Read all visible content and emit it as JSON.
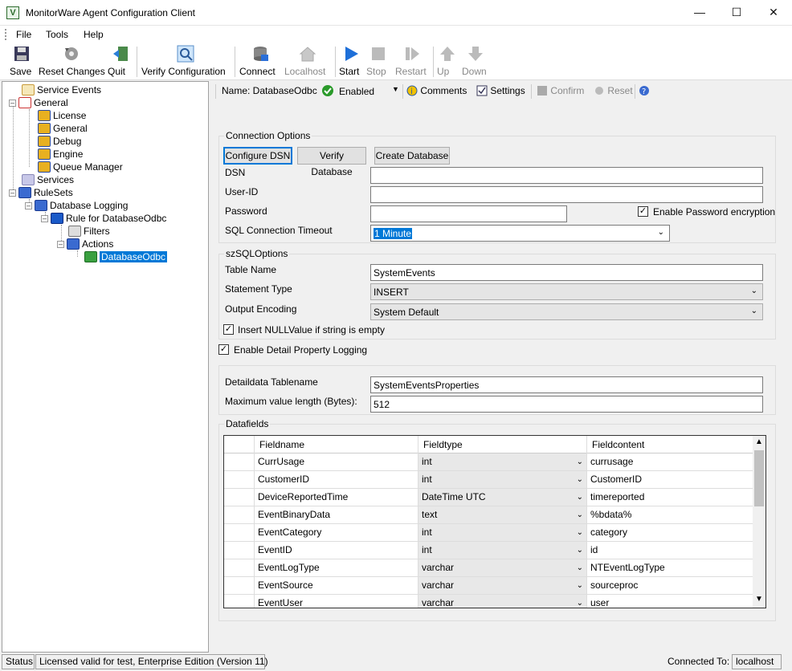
{
  "window": {
    "title": "MonitorWare Agent Configuration Client"
  },
  "menu": [
    "File",
    "Tools",
    "Help"
  ],
  "toolbar": {
    "save": "Save",
    "reset_changes": "Reset Changes",
    "quit": "Quit",
    "verify": "Verify Configuration",
    "connect": "Connect",
    "localhost": "Localhost",
    "start": "Start",
    "stop": "Stop",
    "restart": "Restart",
    "up": "Up",
    "down": "Down"
  },
  "tree": {
    "service_events": "Service Events",
    "general": "General",
    "license": "License",
    "general_child": "General",
    "debug": "Debug",
    "engine": "Engine",
    "queue_manager": "Queue Manager",
    "services": "Services",
    "rulesets": "RuleSets",
    "database_logging": "Database Logging",
    "rule": "Rule for DatabaseOdbc",
    "filters": "Filters",
    "actions": "Actions",
    "action_db": "DatabaseOdbc"
  },
  "action_bar": {
    "name": "Name: DatabaseOdbc",
    "status": "Enabled",
    "comments": "Comments",
    "settings": "Settings",
    "confirm": "Confirm",
    "reset": "Reset"
  },
  "connection": {
    "group": "Connection Options",
    "configure_dsn": "Configure DSN",
    "verify_database": "Verify Database",
    "create_database": "Create Database",
    "dsn_label": "DSN",
    "dsn_value": "",
    "userid_label": "User-ID",
    "userid_value": "",
    "password_label": "Password",
    "password_value": "",
    "encrypt_label": "Enable Password encryption",
    "timeout_label": "SQL Connection Timeout",
    "timeout_value": "1 Minute"
  },
  "sql": {
    "group": "szSQLOptions",
    "table_label": "Table Name",
    "table_value": "SystemEvents",
    "stmt_label": "Statement Type",
    "stmt_value": "INSERT",
    "encoding_label": "Output Encoding",
    "encoding_value": "System Default",
    "null_label": "Insert NULLValue if string is empty"
  },
  "detail_logging_label": "Enable Detail Property Logging",
  "detail": {
    "tablename_label": "Detaildata Tablename",
    "tablename_value": "SystemEventsProperties",
    "maxlen_label": "Maximum value length (Bytes):",
    "maxlen_value": "512"
  },
  "datafields": {
    "group": "Datafields",
    "columns": [
      "Fieldname",
      "Fieldtype",
      "Fieldcontent"
    ],
    "rows": [
      [
        "CurrUsage",
        "int",
        "currusage"
      ],
      [
        "CustomerID",
        "int",
        "CustomerID"
      ],
      [
        "DeviceReportedTime",
        "DateTime UTC",
        "timereported"
      ],
      [
        "EventBinaryData",
        "text",
        "%bdata%"
      ],
      [
        "EventCategory",
        "int",
        "category"
      ],
      [
        "EventID",
        "int",
        "id"
      ],
      [
        "EventLogType",
        "varchar",
        "NTEventLogType"
      ],
      [
        "EventSource",
        "varchar",
        "sourceproc"
      ],
      [
        "EventUser",
        "varchar",
        "user"
      ]
    ]
  },
  "status": {
    "label": "Status",
    "license": "Licensed valid for test, Enterprise Edition (Version 11)",
    "connected_label": "Connected To:",
    "connected_value": "localhost"
  }
}
